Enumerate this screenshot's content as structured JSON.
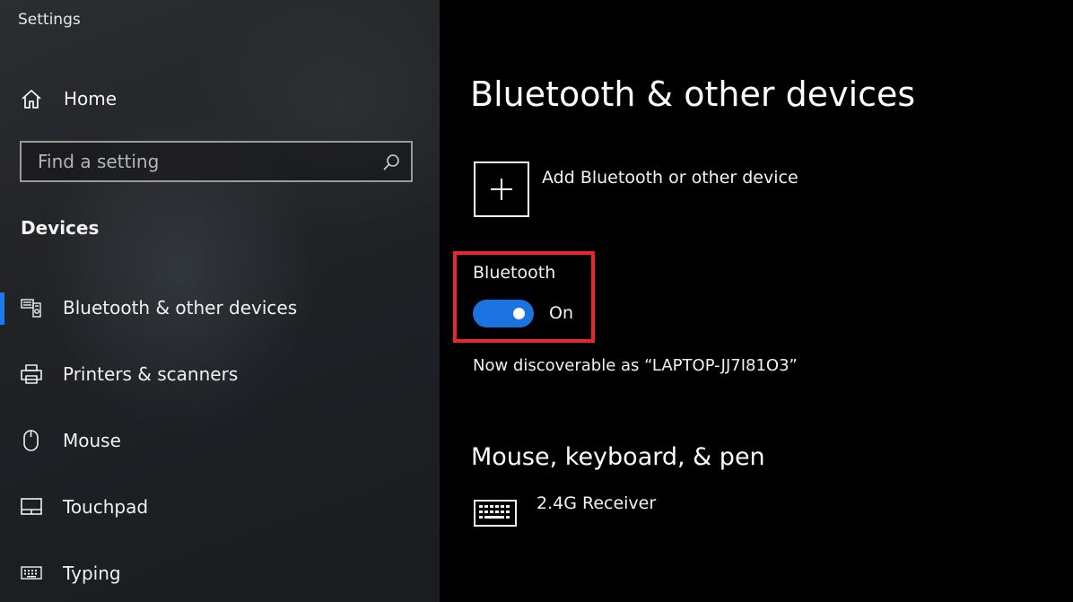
{
  "window": {
    "title": "Settings"
  },
  "sidebar": {
    "home_label": "Home",
    "search": {
      "placeholder": "Find a setting",
      "value": ""
    },
    "section_label": "Devices",
    "items": [
      {
        "label": "Bluetooth & other devices",
        "icon": "bluetooth-devices-icon",
        "selected": true
      },
      {
        "label": "Printers & scanners",
        "icon": "printer-icon",
        "selected": false
      },
      {
        "label": "Mouse",
        "icon": "mouse-icon",
        "selected": false
      },
      {
        "label": "Touchpad",
        "icon": "touchpad-icon",
        "selected": false
      },
      {
        "label": "Typing",
        "icon": "keyboard-icon",
        "selected": false
      }
    ]
  },
  "main": {
    "page_title": "Bluetooth & other devices",
    "add_device_label": "Add Bluetooth or other device",
    "bluetooth": {
      "label": "Bluetooth",
      "state_label": "On",
      "enabled": true
    },
    "discoverable_text": "Now discoverable as “LAPTOP-JJ7I81O3”",
    "section_title": "Mouse, keyboard, & pen",
    "devices": [
      {
        "name": "2.4G Receiver",
        "icon": "keyboard-icon"
      }
    ]
  },
  "colors": {
    "accent": "#1a73e0",
    "selection_bar": "#1a7cf0",
    "highlight_box": "#e8262c",
    "main_background": "#000000",
    "sidebar_background": "#232427"
  }
}
